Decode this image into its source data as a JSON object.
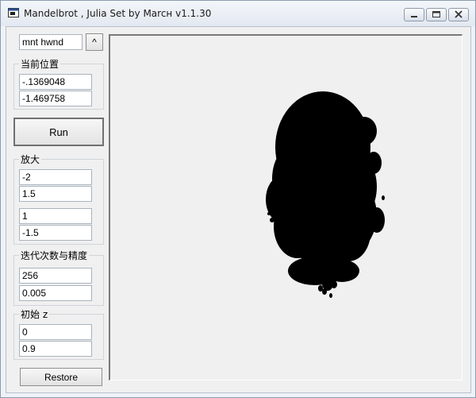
{
  "window": {
    "title": "Mandelbrot , Julia Set by Marcн v1.1.30"
  },
  "controls": {
    "handle_field": "mnt hwnd",
    "handle_button": "^",
    "position": {
      "label": "当前位置",
      "x": "-.1369048",
      "y": "-1.469758"
    },
    "run_label": "Run",
    "zoom": {
      "label": "放大",
      "a": "-2",
      "b": "1.5",
      "c": "1",
      "d": "-1.5"
    },
    "iteration": {
      "label": "迭代次数与精度",
      "iterations": "256",
      "precision": "0.005"
    },
    "initial_z": {
      "label": "初始 z",
      "real": "0",
      "imag": "0.9"
    },
    "restore_label": "Restore"
  },
  "icons": {
    "app": "app-window-icon",
    "minimize": "minimize-icon",
    "maximize": "maximize-icon",
    "close": "close-icon"
  },
  "colors": {
    "fractal": "#000000",
    "canvas_bg": "#f0f0f0"
  }
}
